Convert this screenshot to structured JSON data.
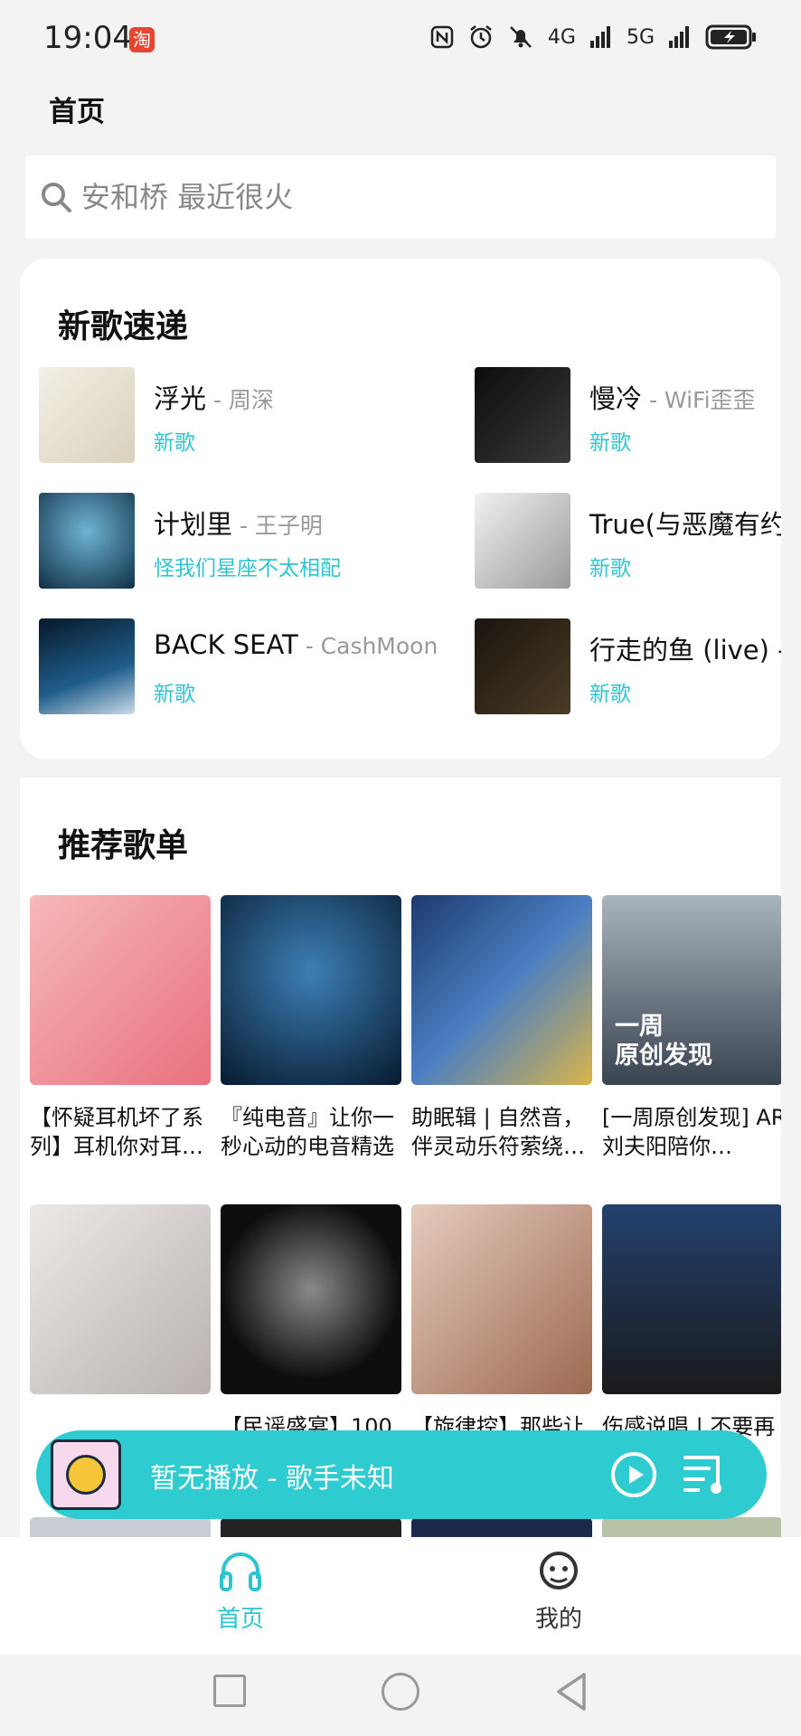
{
  "status_bar": {
    "time": "19:04",
    "badge": "淘",
    "icons": [
      "nfc-icon",
      "alarm-icon",
      "mute-icon",
      "4g-signal-icon",
      "5g-signal-icon",
      "battery-charging-icon"
    ],
    "net1": "4G",
    "net2": "5G"
  },
  "header": {
    "title": "首页"
  },
  "search": {
    "placeholder": "安和桥 最近很火"
  },
  "new_songs": {
    "title": "新歌速递",
    "items": [
      {
        "title": "浮光",
        "artist": " - 周深",
        "tag": "新歌",
        "color": "#e9e4d6"
      },
      {
        "title": "慢冷",
        "artist": " - WiFi歪歪",
        "tag": "新歌",
        "color": "#1b1b1b"
      },
      {
        "title": "计划里",
        "artist": " - 王子明",
        "tag": "怪我们星座不太相配",
        "color": "#1e4e6a"
      },
      {
        "title": "True(与恶魔有约",
        "artist": "",
        "tag": "新歌",
        "color": "#d7d7d7"
      },
      {
        "title": "BACK SEAT",
        "artist": " - CashMoon",
        "tag": "新歌",
        "color": "#0c2b45"
      },
      {
        "title": "行走的鱼 (live) -",
        "artist": "",
        "tag": "新歌",
        "color": "#2a2218"
      }
    ]
  },
  "playlists": {
    "title": "推荐歌单",
    "items": [
      {
        "text": "【怀疑耳机坏了系列】耳机你对耳…",
        "color": "#f19a9a",
        "caption": ""
      },
      {
        "text": "『纯电音』让你一秒心动的电音精选",
        "color": "#0f3354",
        "caption": ""
      },
      {
        "text": "助眠辑 | 自然音，伴灵动乐符萦绕…",
        "color": "#2b4f8f",
        "caption": ""
      },
      {
        "text": "[一周原创发现] AR刘夫阳陪你…",
        "color": "#7b8895",
        "caption": "一周\n原创发现"
      },
      {
        "text": "",
        "color": "#d9d6d4",
        "caption": ""
      },
      {
        "text": "【民谣盛宴】100",
        "color": "#111111",
        "caption": ""
      },
      {
        "text": "【旋律控】那些让",
        "color": "#c9a08a",
        "caption": ""
      },
      {
        "text": "伤感说唱 | 不要再",
        "color": "#2e3d5f",
        "caption": ""
      }
    ]
  },
  "player": {
    "text": "暂无播放 - 歌手未知"
  },
  "tabbar": {
    "home": "首页",
    "me": "我的",
    "active_color": "#2ec4cf"
  }
}
